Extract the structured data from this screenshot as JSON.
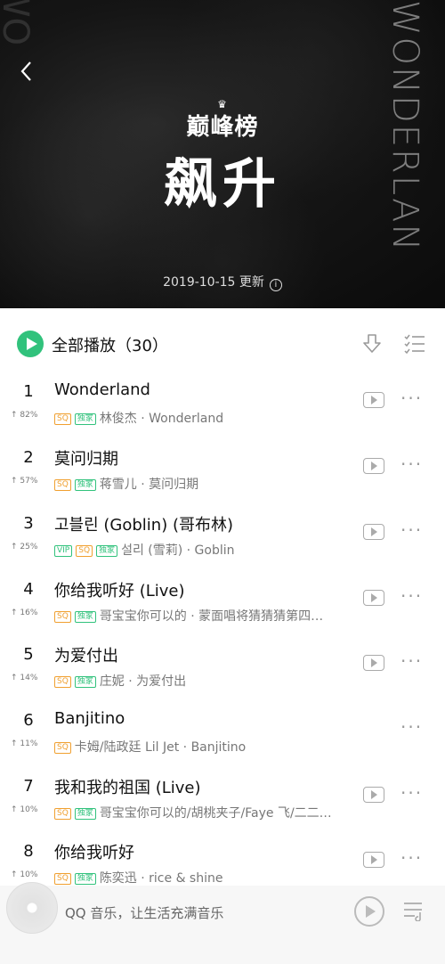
{
  "header": {
    "side_text": "WONDERLAN",
    "side_text_left": "WO",
    "logo_text": "巅峰榜",
    "title": "飙升",
    "updated": "2019-10-15 更新",
    "info_icon": "info-icon",
    "back_icon": "chevron-left-icon"
  },
  "toolbar": {
    "play_all_label": "全部播放（30）",
    "download_icon": "download-icon",
    "multi_select_icon": "multi-select-icon"
  },
  "songs": [
    {
      "rank": "1",
      "trend": "↑ 82%",
      "title": "Wonderland",
      "tags": [
        "SQ",
        "独家"
      ],
      "artist_album": "林俊杰 · Wonderland",
      "has_mv": true
    },
    {
      "rank": "2",
      "trend": "↑ 57%",
      "title": "莫问归期",
      "tags": [
        "SQ",
        "独家"
      ],
      "artist_album": "蒋雪儿 · 莫问归期",
      "has_mv": true
    },
    {
      "rank": "3",
      "trend": "↑ 25%",
      "title": "고블린 (Goblin) (哥布林)",
      "tags": [
        "VIP",
        "SQ",
        "独家"
      ],
      "artist_album": "설리 (雪莉) · Goblin",
      "has_mv": true
    },
    {
      "rank": "4",
      "trend": "↑ 16%",
      "title": "你给我听好 (Live)",
      "tags": [
        "SQ",
        "独家"
      ],
      "artist_album": "哥宝宝你可以的 · 蒙面唱将猜猜猜第四…",
      "has_mv": true
    },
    {
      "rank": "5",
      "trend": "↑ 14%",
      "title": "为爱付出",
      "tags": [
        "SQ",
        "独家"
      ],
      "artist_album": "庄妮 · 为爱付出",
      "has_mv": true
    },
    {
      "rank": "6",
      "trend": "↑ 11%",
      "title": "Banjitino",
      "tags": [
        "SQ"
      ],
      "artist_album": "卡姆/陆政廷 Lil Jet · Banjitino",
      "has_mv": false
    },
    {
      "rank": "7",
      "trend": "↑ 10%",
      "title": "我和我的祖国 (Live)",
      "tags": [
        "SQ",
        "独家"
      ],
      "artist_album": "哥宝宝你可以的/胡桃夹子/Faye 飞/二二…",
      "has_mv": true
    },
    {
      "rank": "8",
      "trend": "↑ 10%",
      "title": "你给我听好",
      "tags": [
        "SQ",
        "独家"
      ],
      "artist_album": "陈奕迅 · rice & shine",
      "has_mv": true
    }
  ],
  "player": {
    "slogan": "QQ 音乐，让生活充满音乐",
    "play_icon": "play-icon",
    "playlist_icon": "playlist-icon"
  },
  "colors": {
    "accent": "#31c27c",
    "sq": "#f0a030"
  }
}
